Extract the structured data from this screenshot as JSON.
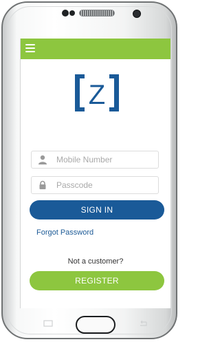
{
  "app": {
    "logo_text": "Z",
    "brand_colors": {
      "green": "#8dc63f",
      "blue": "#1a5a98"
    }
  },
  "topbar": {
    "menu_icon": "hamburger-icon"
  },
  "login": {
    "mobile_placeholder": "Mobile Number",
    "passcode_placeholder": "Passcode",
    "signin_label": "SIGN IN",
    "forgot_label": "Forgot Password",
    "not_customer_text": "Not a customer?",
    "register_label": "REGISTER"
  },
  "icons": {
    "user": "user-icon",
    "lock": "lock-icon",
    "recent_apps": "recent-apps-icon",
    "back": "back-icon"
  }
}
